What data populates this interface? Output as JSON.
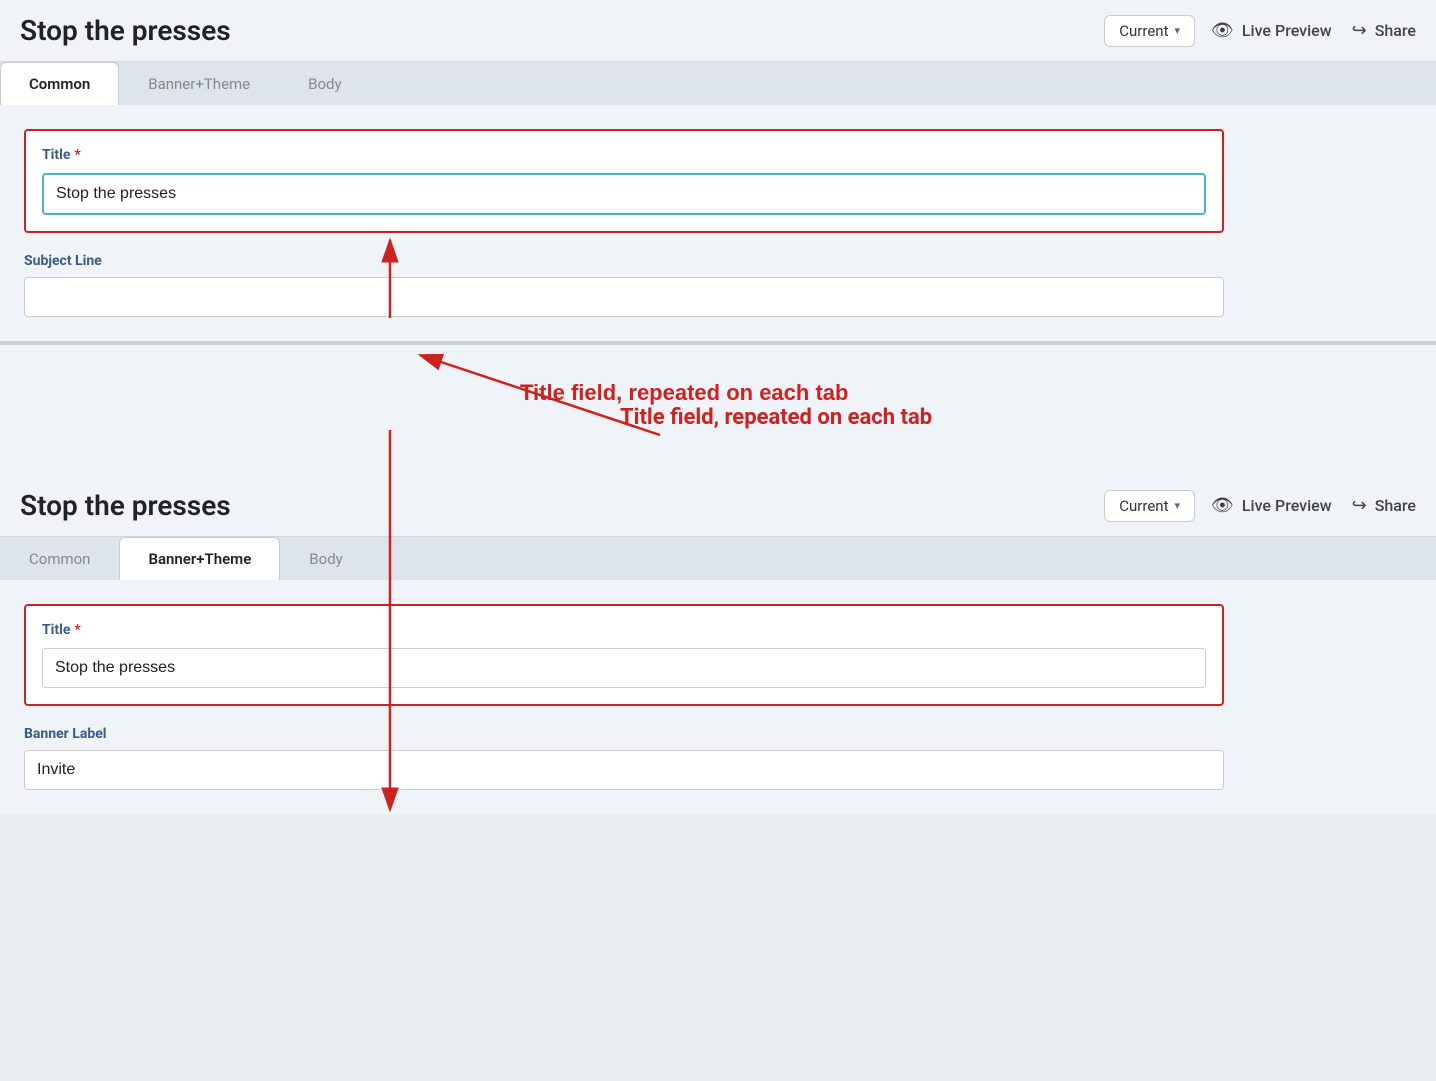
{
  "app": {
    "title": "Stop the presses"
  },
  "top_panel": {
    "header": {
      "title": "Stop the presses",
      "version_label": "Current",
      "live_preview_label": "Live Preview",
      "share_label": "Share"
    },
    "tabs": [
      {
        "id": "common",
        "label": "Common",
        "active": true
      },
      {
        "id": "banner_theme",
        "label": "Banner+Theme",
        "active": false
      },
      {
        "id": "body",
        "label": "Body",
        "active": false
      }
    ],
    "form": {
      "title_label": "Title",
      "title_value": "Stop the presses",
      "subject_label": "Subject Line",
      "subject_value": ""
    }
  },
  "annotation": {
    "text": "Title field, repeated on each tab"
  },
  "bottom_panel": {
    "header": {
      "title": "Stop the presses",
      "version_label": "Current",
      "live_preview_label": "Live Preview",
      "share_label": "Share"
    },
    "tabs": [
      {
        "id": "common",
        "label": "Common",
        "active": false
      },
      {
        "id": "banner_theme",
        "label": "Banner+Theme",
        "active": true
      },
      {
        "id": "body",
        "label": "Body",
        "active": false
      }
    ],
    "form": {
      "title_label": "Title",
      "title_value": "Stop the presses",
      "banner_label": "Banner Label",
      "banner_value": "Invite"
    }
  },
  "icons": {
    "eye": "👁",
    "share": "↪",
    "chevron": "∨"
  }
}
